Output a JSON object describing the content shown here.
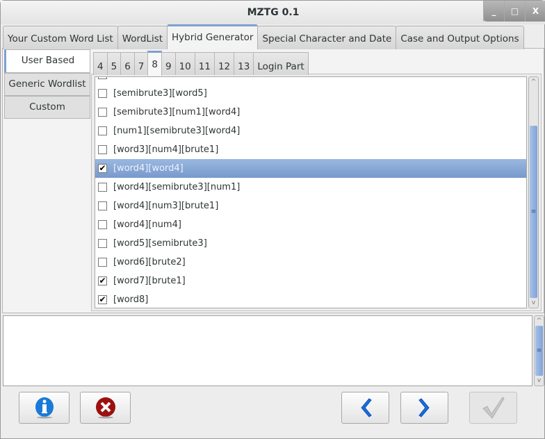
{
  "window": {
    "title": "MZTG 0.1",
    "controls": [
      "_",
      "□",
      "X"
    ]
  },
  "main_tabs": [
    {
      "label": "Your Custom Word List"
    },
    {
      "label": "WordList"
    },
    {
      "label": "Hybrid Generator",
      "active": true
    },
    {
      "label": "Special Character and Date"
    },
    {
      "label": "Case and Output Options"
    }
  ],
  "side_tabs": [
    {
      "label": "User Based",
      "active": true
    },
    {
      "label": "Generic Wordlist"
    },
    {
      "label": "Custom"
    }
  ],
  "length_tabs": [
    {
      "label": "4"
    },
    {
      "label": "5"
    },
    {
      "label": "6"
    },
    {
      "label": "7"
    },
    {
      "label": "8",
      "active": true
    },
    {
      "label": "9"
    },
    {
      "label": "10"
    },
    {
      "label": "11"
    },
    {
      "label": "12"
    },
    {
      "label": "13"
    },
    {
      "label": "Login Part"
    }
  ],
  "patterns": [
    {
      "label": "[semibrute3][word5]",
      "checked": false
    },
    {
      "label": "[semibrute3][num1][word4]",
      "checked": false
    },
    {
      "label": "[num1][semibrute3][word4]",
      "checked": false
    },
    {
      "label": "[word3][num4][brute1]",
      "checked": false
    },
    {
      "label": "[word4][word4]",
      "checked": true,
      "selected": true
    },
    {
      "label": "[word4][semibrute3][num1]",
      "checked": false
    },
    {
      "label": "[word4][num3][brute1]",
      "checked": false
    },
    {
      "label": "[word4][num4]",
      "checked": false
    },
    {
      "label": "[word5][semibrute3]",
      "checked": false
    },
    {
      "label": "[word6][brute2]",
      "checked": false
    },
    {
      "label": "[word7][brute1]",
      "checked": true
    },
    {
      "label": "[word8]",
      "checked": true
    }
  ],
  "list_scroll_percent": 70,
  "output_text": "",
  "buttons": {
    "info": "info-icon",
    "cancel": "cancel-icon",
    "back": "chevron-left-icon",
    "next": "chevron-right-icon",
    "finish": "check-icon",
    "finish_enabled": false
  },
  "colors": {
    "accent": "#7e9fd1",
    "selection": "#88a8d6",
    "info": "#1a7ad8",
    "cancel": "#9c1010"
  }
}
